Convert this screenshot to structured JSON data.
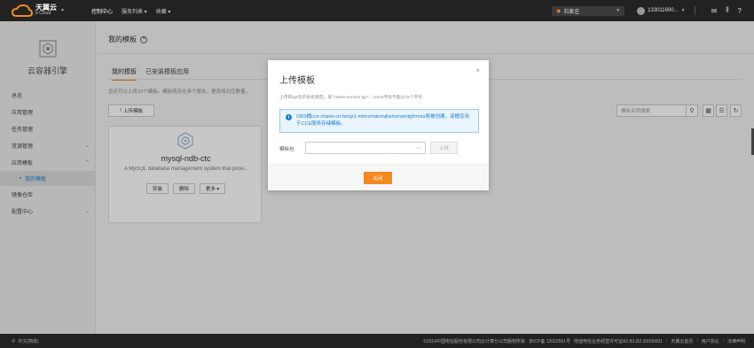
{
  "topbar": {
    "logo_line1": "天翼云",
    "logo_line2": "e Cloud",
    "nav": [
      {
        "label": "控制中心"
      },
      {
        "label": "服务列表 ▾"
      },
      {
        "label": "收藏 ▾"
      }
    ],
    "region": "石家庄",
    "user": "133011690..."
  },
  "sidebar": {
    "title": "云容器引擎",
    "items": [
      {
        "label": "总览",
        "arrow": ""
      },
      {
        "label": "应用管理",
        "arrow": ""
      },
      {
        "label": "任务管理",
        "arrow": ""
      },
      {
        "label": "资源管理",
        "arrow": "⌄"
      },
      {
        "label": "应用模板",
        "arrow": "⌃"
      },
      {
        "label": "我的模板",
        "arrow": ""
      },
      {
        "label": "镜像仓库",
        "arrow": ""
      },
      {
        "label": "配置中心",
        "arrow": "⌄"
      }
    ]
  },
  "main": {
    "title": "我的模板",
    "tabs": [
      "我的模板",
      "已安装模板应用"
    ],
    "hint": "您还可以上传19个模板。模板将存在多个版本，更改将对应数量。",
    "upload_label": "上传模板",
    "search_placeholder": "模板名称搜索",
    "card": {
      "name": "mysql-ndb-ctc",
      "desc": "A MySQL database management system that provi...",
      "buttons": [
        "安装",
        "删除",
        "更多 ▾"
      ]
    }
  },
  "modal": {
    "title": "上传模板",
    "note": "上传的tgz包的命名规范，如 \"name-version.tgz\"，name字段不超过15个字符",
    "info": "OBS桶cce-charts-cn-hesjz1-mtmzmdexnjkwmznamtg5mmu将被创建，该桶仅用于CCE服务存储模板。",
    "file_label": "模板包",
    "file_btn": "···",
    "upload_btn": "上传",
    "close_btn": "关闭"
  },
  "footer": {
    "lang": "中文(简体)",
    "copyright": "©2019中国电信股份有限公司云计算分公司版权所有",
    "icp": "京ICP备 12022551号",
    "license": "增值电信业务经营许可证A2.B1.B2-20090001",
    "links": [
      "天翼云首页",
      "用户协议",
      "法律声明"
    ]
  }
}
